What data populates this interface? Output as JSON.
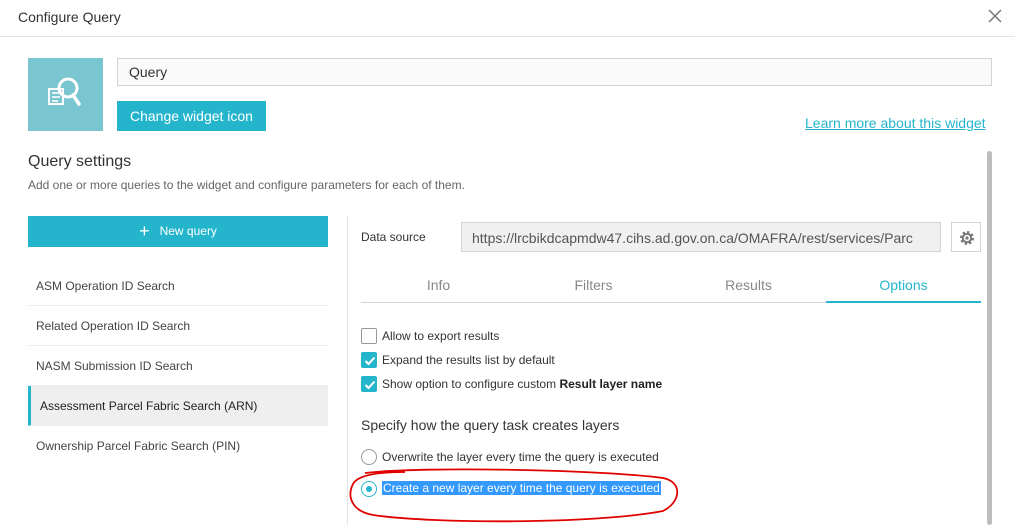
{
  "dialog": {
    "title": "Configure Query",
    "close_icon": "close-icon"
  },
  "widget": {
    "icon": "query-widget-icon",
    "name_value": "Query",
    "change_icon_label": "Change widget icon",
    "learn_more_label": "Learn more about this widget"
  },
  "settings": {
    "title": "Query settings",
    "description": "Add one or more queries to the widget and configure parameters for each of them."
  },
  "queries": {
    "new_label": "New query",
    "items": [
      {
        "label": "ASM Operation ID Search"
      },
      {
        "label": "Related Operation ID Search"
      },
      {
        "label": "NASM Submission ID Search"
      },
      {
        "label": "Assessment Parcel Fabric Search (ARN)",
        "selected": true
      },
      {
        "label": "Ownership Parcel Fabric Search (PIN)"
      }
    ]
  },
  "datasource": {
    "label": "Data source",
    "value": "https://lrcbikdcapmdw47.cihs.ad.gov.on.ca/OMAFRA/rest/services/Parc",
    "settings_icon": "gear-icon"
  },
  "tabs": [
    {
      "label": "Info"
    },
    {
      "label": "Filters"
    },
    {
      "label": "Results"
    },
    {
      "label": "Options",
      "active": true
    }
  ],
  "options": {
    "checkboxes": [
      {
        "label": "Allow to export results",
        "checked": false
      },
      {
        "label": "Expand the results list by default",
        "checked": true
      },
      {
        "label_prefix": "Show option to configure custom ",
        "label_bold": "Result layer name",
        "checked": true
      }
    ],
    "layer_section_title": "Specify how the query task creates layers",
    "radios": [
      {
        "label": "Overwrite the layer every time the query is executed",
        "checked": false
      },
      {
        "label": "Create a new layer every time the query is executed",
        "checked": true,
        "highlighted": true
      }
    ]
  },
  "colors": {
    "accent": "#24b5cc",
    "icon_bg": "#7ac6d0",
    "selection_highlight": "#3399ff",
    "annotation_red": "#e00000"
  }
}
